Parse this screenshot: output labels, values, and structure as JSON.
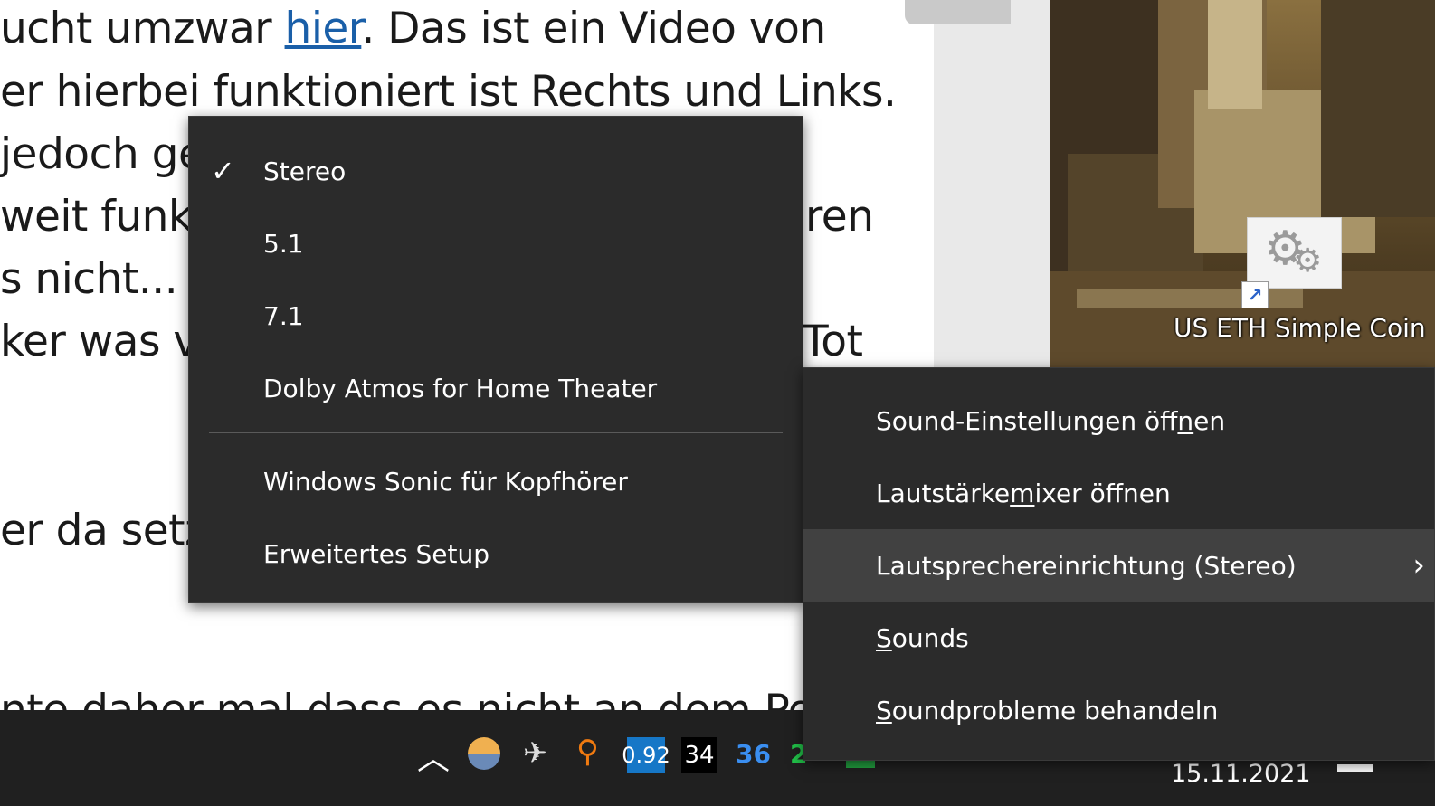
{
  "article": {
    "lines": [
      {
        "pre": "ucht umzwar ",
        "link": "hier",
        "post": ". Das ist ein Video von"
      },
      {
        "text": "er hierbei funktioniert ist Rechts und Links."
      },
      {
        "text": "jedoch ge"
      },
      {
        "text": "weit funkt",
        "right": "ren"
      },
      {
        "text": "s nicht... H"
      },
      {
        "text": "ker was vo",
        "right": "Tot"
      },
      {
        "text": "er da setzt"
      },
      {
        "text": "nte daher mal dass es nicht an dem Possi"
      }
    ]
  },
  "desktop": {
    "icon_label": "US ETH Simple Coin"
  },
  "speaker_menu": {
    "items": [
      {
        "label": "Stereo",
        "checked": true
      },
      {
        "label": "5.1",
        "checked": false
      },
      {
        "label": "7.1",
        "checked": false
      },
      {
        "label": "Dolby Atmos for Home Theater",
        "checked": false
      },
      {
        "label": "Windows Sonic für Kopfhörer",
        "checked": false
      },
      {
        "label": "Erweitertes Setup",
        "checked": false
      }
    ]
  },
  "context_menu": {
    "items": [
      {
        "pre": "Sound-Einstellungen öff",
        "mn": "n",
        "post": "en"
      },
      {
        "pre": "Lautstärke",
        "mn": "m",
        "post": "ixer öffnen"
      },
      {
        "pre": "Lautsprechereinrichtung (Stereo)",
        "mn": "",
        "post": "",
        "submenu": true,
        "highlighted": true
      },
      {
        "pre": "",
        "mn": "S",
        "post": "ounds"
      },
      {
        "pre": "",
        "mn": "S",
        "post": "oundprobleme behandeln"
      }
    ]
  },
  "taskbar": {
    "tray": [
      {
        "icon": "chevron-up-icon",
        "text": "^"
      },
      {
        "icon": "weather-icon",
        "text": ""
      },
      {
        "icon": "airplane-icon",
        "text": ""
      },
      {
        "icon": "search-icon",
        "text": ""
      },
      {
        "icon": "cpu-load-badge",
        "text": "0.92"
      },
      {
        "icon": "temp-badge",
        "text": "34"
      },
      {
        "icon": "temp-badge-blue",
        "text": "36"
      }
    ],
    "date": "15.11.2021"
  },
  "colors": {
    "menu_bg": "#2b2b2b",
    "menu_highlight": "#414141",
    "link": "#1a5fa8",
    "taskbar": "#202020"
  }
}
